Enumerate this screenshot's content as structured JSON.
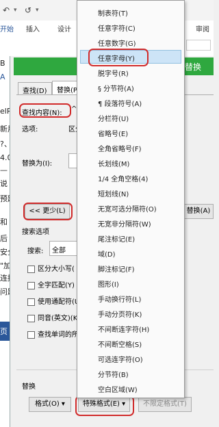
{
  "ribbon": {
    "tabs": [
      "开始",
      "插入",
      "设计",
      "审阅"
    ],
    "undo_glyph": "↶",
    "redo_glyph": "↺",
    "dropdown_glyph": "▾"
  },
  "document": {
    "strip_lines": [
      "B",
      "A",
      "elP",
      "新用",
      "?、",
      "4.0",
      "—",
      "说",
      "预题",
      "和",
      "后",
      "安全",
      "\"加",
      "连接",
      "问题",
      "页"
    ]
  },
  "dialog": {
    "title": "替换",
    "tabs": {
      "find": "查找(D)",
      "replace": "替换(P"
    },
    "find_label": "查找内容(N):",
    "find_value": "^$",
    "options_label": "选项:",
    "options_value": "区分",
    "replace_label": "替换为(I):",
    "less_button": "<< 更少(L)",
    "replace_button": "替换(A)",
    "search_options_heading": "搜索选项",
    "search_label": "搜索:",
    "search_value": "全部",
    "checkboxes": [
      "区分大小写(",
      "全字匹配(Y)",
      "使用通配符(U",
      "同音(英文)(K",
      "查找单词的所"
    ],
    "replace_section": "替换",
    "format_button": "格式(O) ▾",
    "special_button": "特殊格式(E) ▾",
    "no_format_button": "不限定格式(T)"
  },
  "menu": {
    "items": [
      "制表符(T)",
      "任意字符(C)",
      "任意数字(G)",
      "任意字母(Y)",
      "脱字号(R)",
      "§ 分节符(A)",
      "¶ 段落符号(A)",
      "分栏符(U)",
      "省略号(E)",
      "全角省略号(F)",
      "长划线(M)",
      "1/4 全角空格(4)",
      "短划线(N)",
      "无宽可选分隔符(O)",
      "无宽非分隔符(W)",
      "尾注标记(E)",
      "域(D)",
      "脚注标记(F)",
      "图形(I)",
      "手动换行符(L)",
      "手动分页符(K)",
      "不间断连字符(H)",
      "不间断空格(S)",
      "可选连字符(O)",
      "分节符(B)",
      "空白区域(W)"
    ],
    "highlighted_index": 3
  },
  "colors": {
    "title_green": "#2fa83f",
    "highlight": "#cde4f7",
    "annotation_red": "#d12a2a",
    "word_blue": "#2b579a"
  }
}
